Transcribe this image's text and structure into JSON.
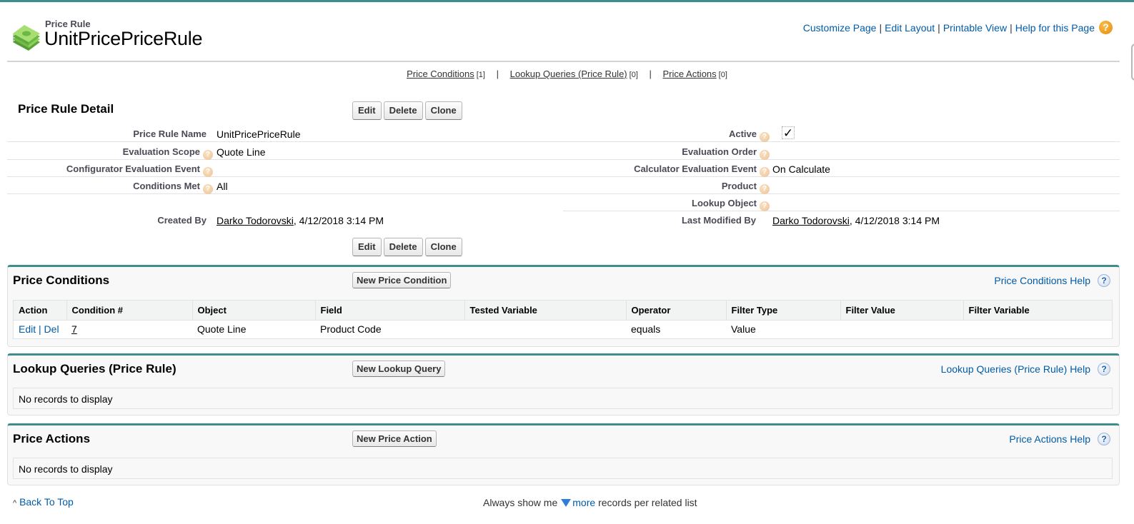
{
  "header": {
    "object_type": "Price Rule",
    "title": "UnitPricePriceRule",
    "links": [
      "Customize Page",
      "Edit Layout",
      "Printable View",
      "Help for this Page"
    ],
    "help_icon": "?"
  },
  "related_links": [
    {
      "label": "Price Conditions",
      "count": "[1]"
    },
    {
      "label": "Lookup Queries (Price Rule)",
      "count": "[0]"
    },
    {
      "label": "Price Actions",
      "count": "[0]"
    }
  ],
  "detail": {
    "title": "Price Rule Detail",
    "buttons": [
      "Edit",
      "Delete",
      "Clone"
    ],
    "left_fields": [
      {
        "label": "Price Rule Name",
        "value": "UnitPricePriceRule",
        "help": false
      },
      {
        "label": "Evaluation Scope",
        "value": "Quote Line",
        "help": true
      },
      {
        "label": "Configurator Evaluation Event",
        "value": "",
        "help": true
      },
      {
        "label": "Conditions Met",
        "value": "All",
        "help": true
      }
    ],
    "right_fields": [
      {
        "label": "Active",
        "value": "checked",
        "help": true
      },
      {
        "label": "Evaluation Order",
        "value": "",
        "help": true
      },
      {
        "label": "Calculator Evaluation Event",
        "value": "On Calculate",
        "help": true
      },
      {
        "label": "Product",
        "value": "",
        "help": true
      },
      {
        "label": "Lookup Object",
        "value": "",
        "help": true
      }
    ],
    "created_by": {
      "label": "Created By",
      "user": "Darko Todorovski",
      "date": ", 4/12/2018 3:14 PM"
    },
    "last_modified_by": {
      "label": "Last Modified By",
      "user": "Darko Todorovski",
      "date": ", 4/12/2018 3:14 PM"
    },
    "checkmark": "✓"
  },
  "price_conditions": {
    "title": "Price Conditions",
    "new_button": "New Price Condition",
    "help_link": "Price Conditions Help",
    "columns": [
      "Action",
      "Condition #",
      "Object",
      "Field",
      "Tested Variable",
      "Operator",
      "Filter Type",
      "Filter Value",
      "Filter Variable"
    ],
    "rows": [
      {
        "edit": "Edit",
        "del": "Del",
        "condition_num": "7",
        "object": "Quote Line",
        "field": "Product Code",
        "tested_variable": "",
        "operator": "equals",
        "filter_type": "Value",
        "filter_value": "",
        "filter_variable": ""
      }
    ]
  },
  "lookup_queries": {
    "title": "Lookup Queries (Price Rule)",
    "new_button": "New Lookup Query",
    "help_link": "Lookup Queries (Price Rule) Help",
    "empty_text": "No records to display"
  },
  "price_actions": {
    "title": "Price Actions",
    "new_button": "New Price Action",
    "help_link": "Price Actions Help",
    "empty_text": "No records to display"
  },
  "footer": {
    "back_to_top": "Back To Top",
    "always_show_prefix": "Always show me",
    "more": "more",
    "always_show_suffix": "records per related list"
  }
}
